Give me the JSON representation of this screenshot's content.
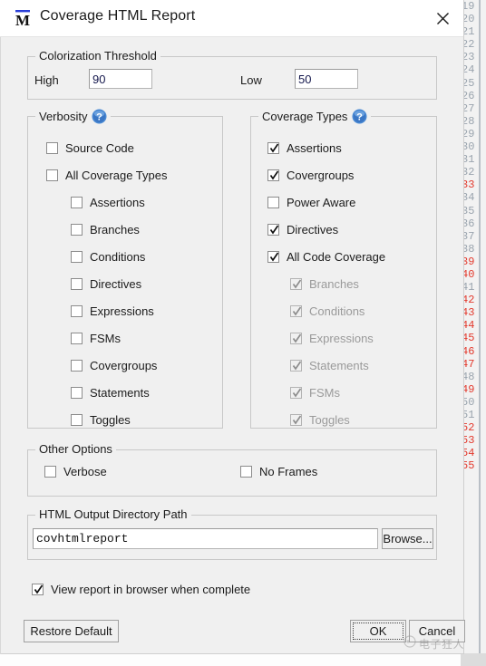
{
  "window": {
    "title": "Coverage HTML Report",
    "logo_icon": "mentor-m-logo",
    "close_icon": "close-icon"
  },
  "colorization": {
    "legend": "Colorization Threshold",
    "high_label": "High",
    "high_value": "90",
    "low_label": "Low",
    "low_value": "50"
  },
  "verbosity": {
    "legend": "Verbosity",
    "help_icon": "help-question-icon",
    "items": [
      {
        "label": "Source Code",
        "checked": false,
        "disabled": false,
        "indent": 0
      },
      {
        "label": "All Coverage Types",
        "checked": false,
        "disabled": false,
        "indent": 0
      },
      {
        "label": "Assertions",
        "checked": false,
        "disabled": false,
        "indent": 1
      },
      {
        "label": "Branches",
        "checked": false,
        "disabled": false,
        "indent": 1
      },
      {
        "label": "Conditions",
        "checked": false,
        "disabled": false,
        "indent": 1
      },
      {
        "label": "Directives",
        "checked": false,
        "disabled": false,
        "indent": 1
      },
      {
        "label": "Expressions",
        "checked": false,
        "disabled": false,
        "indent": 1
      },
      {
        "label": "FSMs",
        "checked": false,
        "disabled": false,
        "indent": 1
      },
      {
        "label": "Covergroups",
        "checked": false,
        "disabled": false,
        "indent": 1
      },
      {
        "label": "Statements",
        "checked": false,
        "disabled": false,
        "indent": 1
      },
      {
        "label": "Toggles",
        "checked": false,
        "disabled": false,
        "indent": 1
      }
    ]
  },
  "coverage_types": {
    "legend": "Coverage Types",
    "help_icon": "help-question-icon",
    "items": [
      {
        "label": "Assertions",
        "checked": true,
        "disabled": false,
        "indent": 0
      },
      {
        "label": "Covergroups",
        "checked": true,
        "disabled": false,
        "indent": 0
      },
      {
        "label": "Power Aware",
        "checked": false,
        "disabled": false,
        "indent": 0
      },
      {
        "label": "Directives",
        "checked": true,
        "disabled": false,
        "indent": 0
      },
      {
        "label": "All Code Coverage",
        "checked": true,
        "disabled": false,
        "indent": 0
      },
      {
        "label": "Branches",
        "checked": true,
        "disabled": true,
        "indent": 1
      },
      {
        "label": "Conditions",
        "checked": true,
        "disabled": true,
        "indent": 1
      },
      {
        "label": "Expressions",
        "checked": true,
        "disabled": true,
        "indent": 1
      },
      {
        "label": "Statements",
        "checked": true,
        "disabled": true,
        "indent": 1
      },
      {
        "label": "FSMs",
        "checked": true,
        "disabled": true,
        "indent": 1
      },
      {
        "label": "Toggles",
        "checked": true,
        "disabled": true,
        "indent": 1
      }
    ]
  },
  "other_options": {
    "legend": "Other Options",
    "verbose": {
      "label": "Verbose",
      "checked": false
    },
    "no_frames": {
      "label": "No Frames",
      "checked": false
    }
  },
  "output_path": {
    "legend": "HTML Output Directory Path",
    "value": "covhtmlreport",
    "browse_label": "Browse..."
  },
  "view_report": {
    "label": "View report in browser when complete",
    "checked": true
  },
  "buttons": {
    "restore_default": "Restore Default",
    "ok": "OK",
    "cancel": "Cancel"
  },
  "watermark": {
    "text": "电子狂人",
    "icon": "watermark-logo-icon"
  },
  "background_editor": {
    "line_numbers": [
      {
        "n": "19",
        "red": false
      },
      {
        "n": "20",
        "red": false
      },
      {
        "n": "21",
        "red": false
      },
      {
        "n": "22",
        "red": false
      },
      {
        "n": "23",
        "red": false
      },
      {
        "n": "24",
        "red": false
      },
      {
        "n": "25",
        "red": false
      },
      {
        "n": "26",
        "red": false
      },
      {
        "n": "27",
        "red": false
      },
      {
        "n": "28",
        "red": false
      },
      {
        "n": "29",
        "red": false
      },
      {
        "n": "30",
        "red": false
      },
      {
        "n": "31",
        "red": false
      },
      {
        "n": "32",
        "red": false
      },
      {
        "n": "33",
        "red": true
      },
      {
        "n": "34",
        "red": false
      },
      {
        "n": "35",
        "red": false
      },
      {
        "n": "36",
        "red": false
      },
      {
        "n": "37",
        "red": false
      },
      {
        "n": "38",
        "red": false
      },
      {
        "n": "39",
        "red": true
      },
      {
        "n": "40",
        "red": true
      },
      {
        "n": "41",
        "red": false
      },
      {
        "n": "42",
        "red": true
      },
      {
        "n": "43",
        "red": true
      },
      {
        "n": "44",
        "red": true
      },
      {
        "n": "45",
        "red": true
      },
      {
        "n": "46",
        "red": true
      },
      {
        "n": "47",
        "red": true
      },
      {
        "n": "48",
        "red": false
      },
      {
        "n": "49",
        "red": true
      },
      {
        "n": "50",
        "red": false
      },
      {
        "n": "51",
        "red": false
      },
      {
        "n": "52",
        "red": true
      },
      {
        "n": "53",
        "red": true
      },
      {
        "n": "54",
        "red": true
      },
      {
        "n": "55",
        "red": true
      }
    ]
  },
  "colors": {
    "dialog_bg": "#f0f0f0",
    "titlebar_bg": "#ffffff",
    "group_border": "#c8c8c8",
    "text": "#1b1b1b",
    "disabled_text": "#9a9a9a",
    "field_text": "#15184d",
    "help_blue": "#3c7fd0",
    "error_red": "#e33a2e"
  }
}
